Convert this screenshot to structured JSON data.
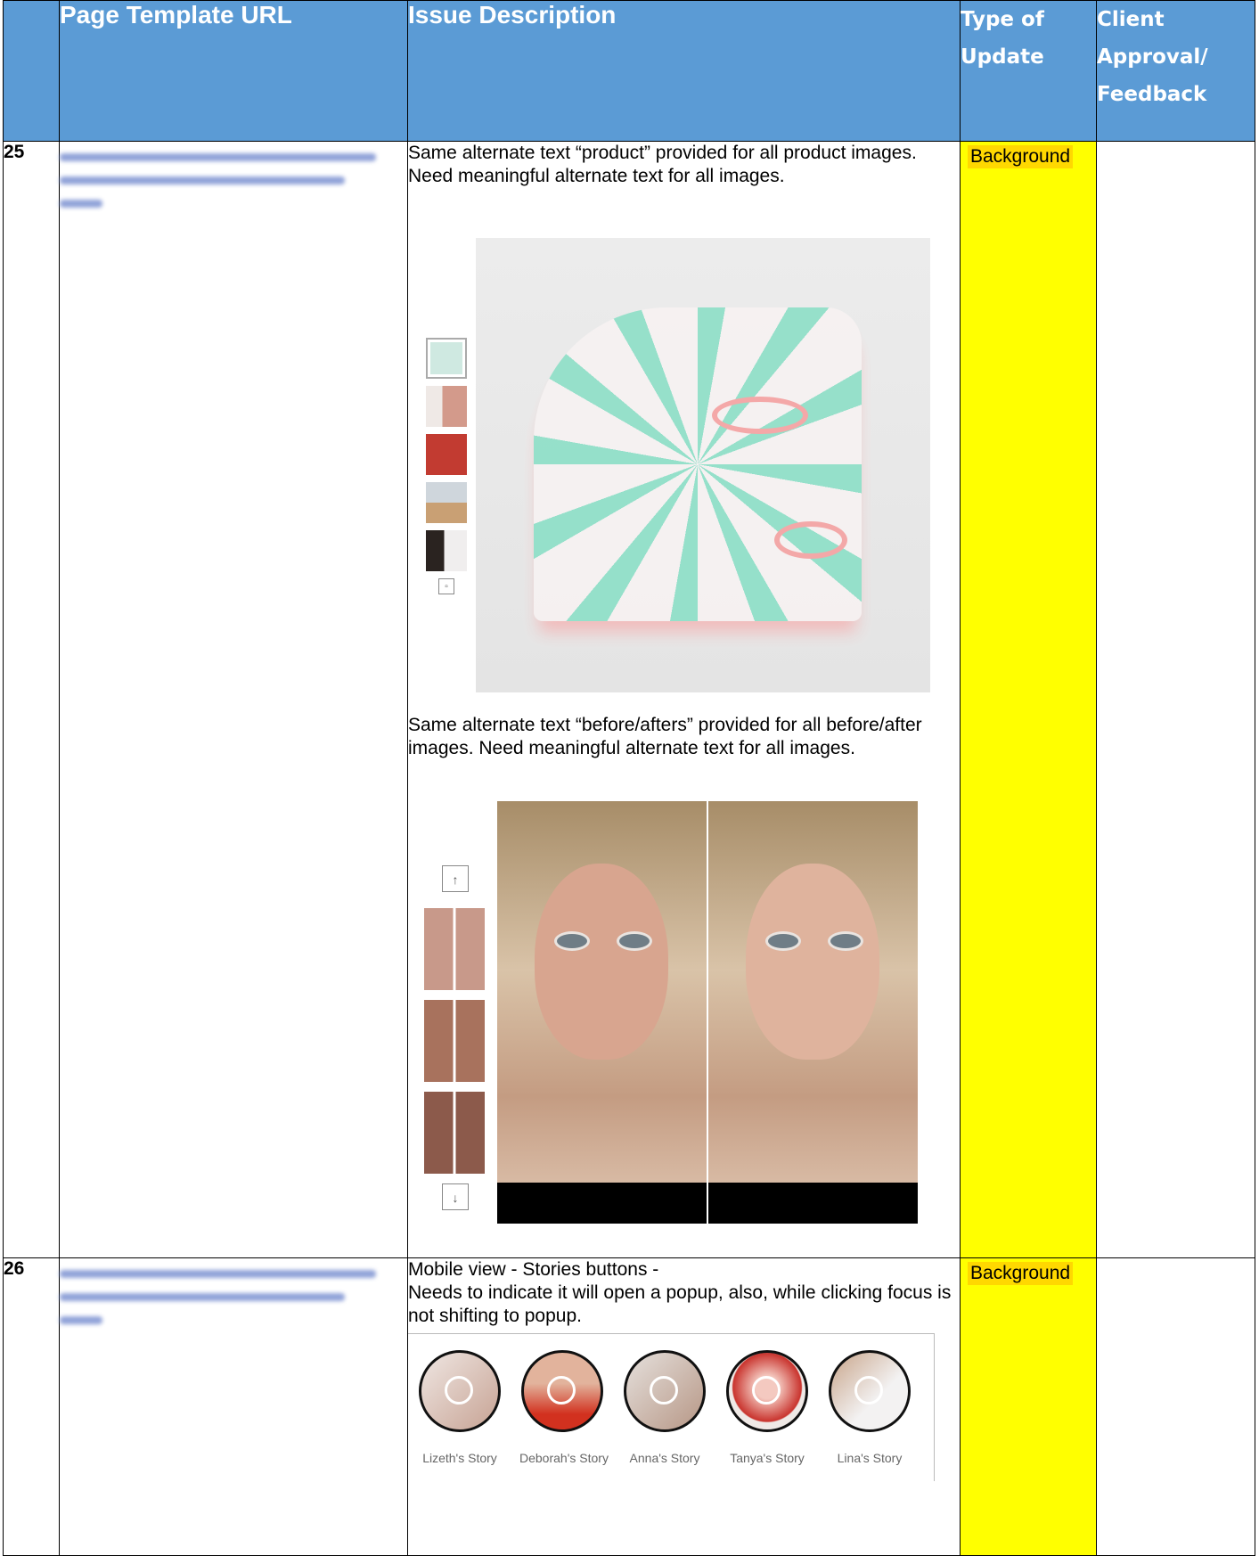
{
  "headers": {
    "page_template_url": "Page Template URL",
    "issue_description": "Issue Description",
    "type_of_update": "Type of Update",
    "client_approval": "Client Approval/ Feedback"
  },
  "rows": [
    {
      "number": "25",
      "issue_1": "Same alternate text “product” provided for all product images. Need meaningful alternate text for all images.",
      "issue_2": "Same alternate text “before/afters” provided for all before/after images. Need meaningful alternate text for all images.",
      "type": "Background"
    },
    {
      "number": "26",
      "issue_1": "Mobile view - Stories buttons -",
      "issue_2": "Needs to indicate it will open a popup, also, while clicking focus is not shifting to popup.",
      "type": "Background",
      "stories": [
        "Lizeth's Story",
        "Deborah's Story",
        "Anna's Story",
        "Tanya's Story",
        "Lina's Story"
      ]
    }
  ],
  "gallery_arrows": {
    "up": "↑",
    "down": "↓"
  },
  "colors": {
    "header_bg": "#5b9bd5",
    "type_bg": "#ffff00",
    "highlight": "#ffd800"
  }
}
